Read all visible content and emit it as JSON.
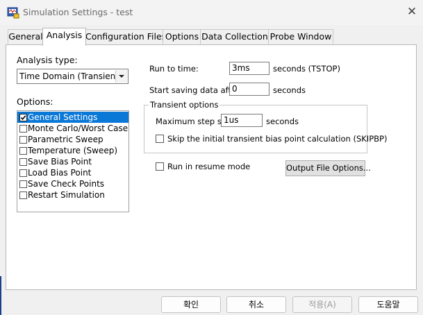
{
  "window": {
    "title": "Simulation Settings - test",
    "close_label": "✕"
  },
  "tabs": [
    "General",
    "Analysis",
    "Configuration Files",
    "Options",
    "Data Collection",
    "Probe Window"
  ],
  "active_tab": "Analysis",
  "analysis": {
    "type_label": "Analysis type:",
    "type_value": "Time Domain (Transient)",
    "options_label": "Options:",
    "options": [
      {
        "label": "General Settings",
        "checked": true,
        "selected": true
      },
      {
        "label": "Monte Carlo/Worst Case",
        "checked": false,
        "selected": false
      },
      {
        "label": "Parametric Sweep",
        "checked": false,
        "selected": false
      },
      {
        "label": "Temperature (Sweep)",
        "checked": false,
        "selected": false
      },
      {
        "label": "Save Bias Point",
        "checked": false,
        "selected": false
      },
      {
        "label": "Load Bias Point",
        "checked": false,
        "selected": false
      },
      {
        "label": "Save Check Points",
        "checked": false,
        "selected": false
      },
      {
        "label": "Restart Simulation",
        "checked": false,
        "selected": false
      }
    ]
  },
  "settings": {
    "run_to_label": "Run to time:",
    "run_to_value": "3ms",
    "run_to_unit": "seconds  (TSTOP)",
    "start_saving_label": "Start saving data after:",
    "start_saving_value": "0",
    "start_saving_unit": "seconds",
    "transient_group_title": "Transient options",
    "max_step_label": "Maximum step size:",
    "max_step_value": "1us",
    "max_step_unit": "seconds",
    "skipbp_label": "Skip the initial transient bias point calculation  (SKIPBP)",
    "skipbp_checked": false,
    "resume_label": "Run in resume mode",
    "resume_checked": false,
    "output_file_options_label": "Output File Options..."
  },
  "footer": {
    "ok": "확인",
    "cancel": "취소",
    "apply": "적용(A)",
    "help": "도움말"
  },
  "colors": {
    "selection": "#0a78d7",
    "window_bg": "#f0f0f0",
    "panel_bg": "#ffffff"
  }
}
